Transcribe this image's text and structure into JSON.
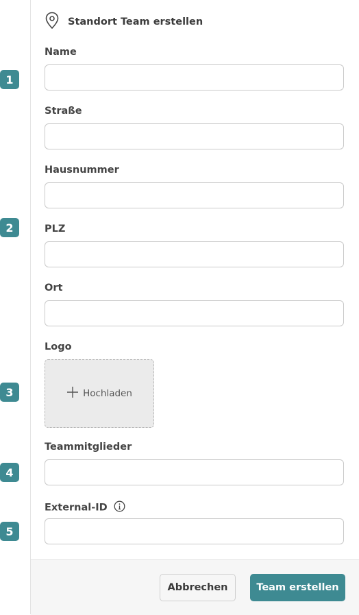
{
  "header": {
    "title": "Standort Team erstellen",
    "icon": "map-pin-icon"
  },
  "form": {
    "name": {
      "label": "Name",
      "value": ""
    },
    "street": {
      "label": "Straße",
      "value": ""
    },
    "house_number": {
      "label": "Hausnummer",
      "value": ""
    },
    "zip": {
      "label": "PLZ",
      "value": ""
    },
    "city": {
      "label": "Ort",
      "value": ""
    },
    "logo": {
      "label": "Logo",
      "upload_label": "Hochladen",
      "icon": "plus-icon"
    },
    "team_members": {
      "label": "Teammitglieder",
      "value": ""
    },
    "external_id": {
      "label": "External-ID",
      "value": "",
      "icon": "info-icon"
    }
  },
  "markers": [
    "1",
    "2",
    "3",
    "4",
    "5"
  ],
  "footer": {
    "cancel_label": "Abbrechen",
    "submit_label": "Team erstellen"
  },
  "colors": {
    "accent": "#3e8a92",
    "upload_bg": "#ebebeb",
    "footer_bg": "#f6f6f6"
  }
}
